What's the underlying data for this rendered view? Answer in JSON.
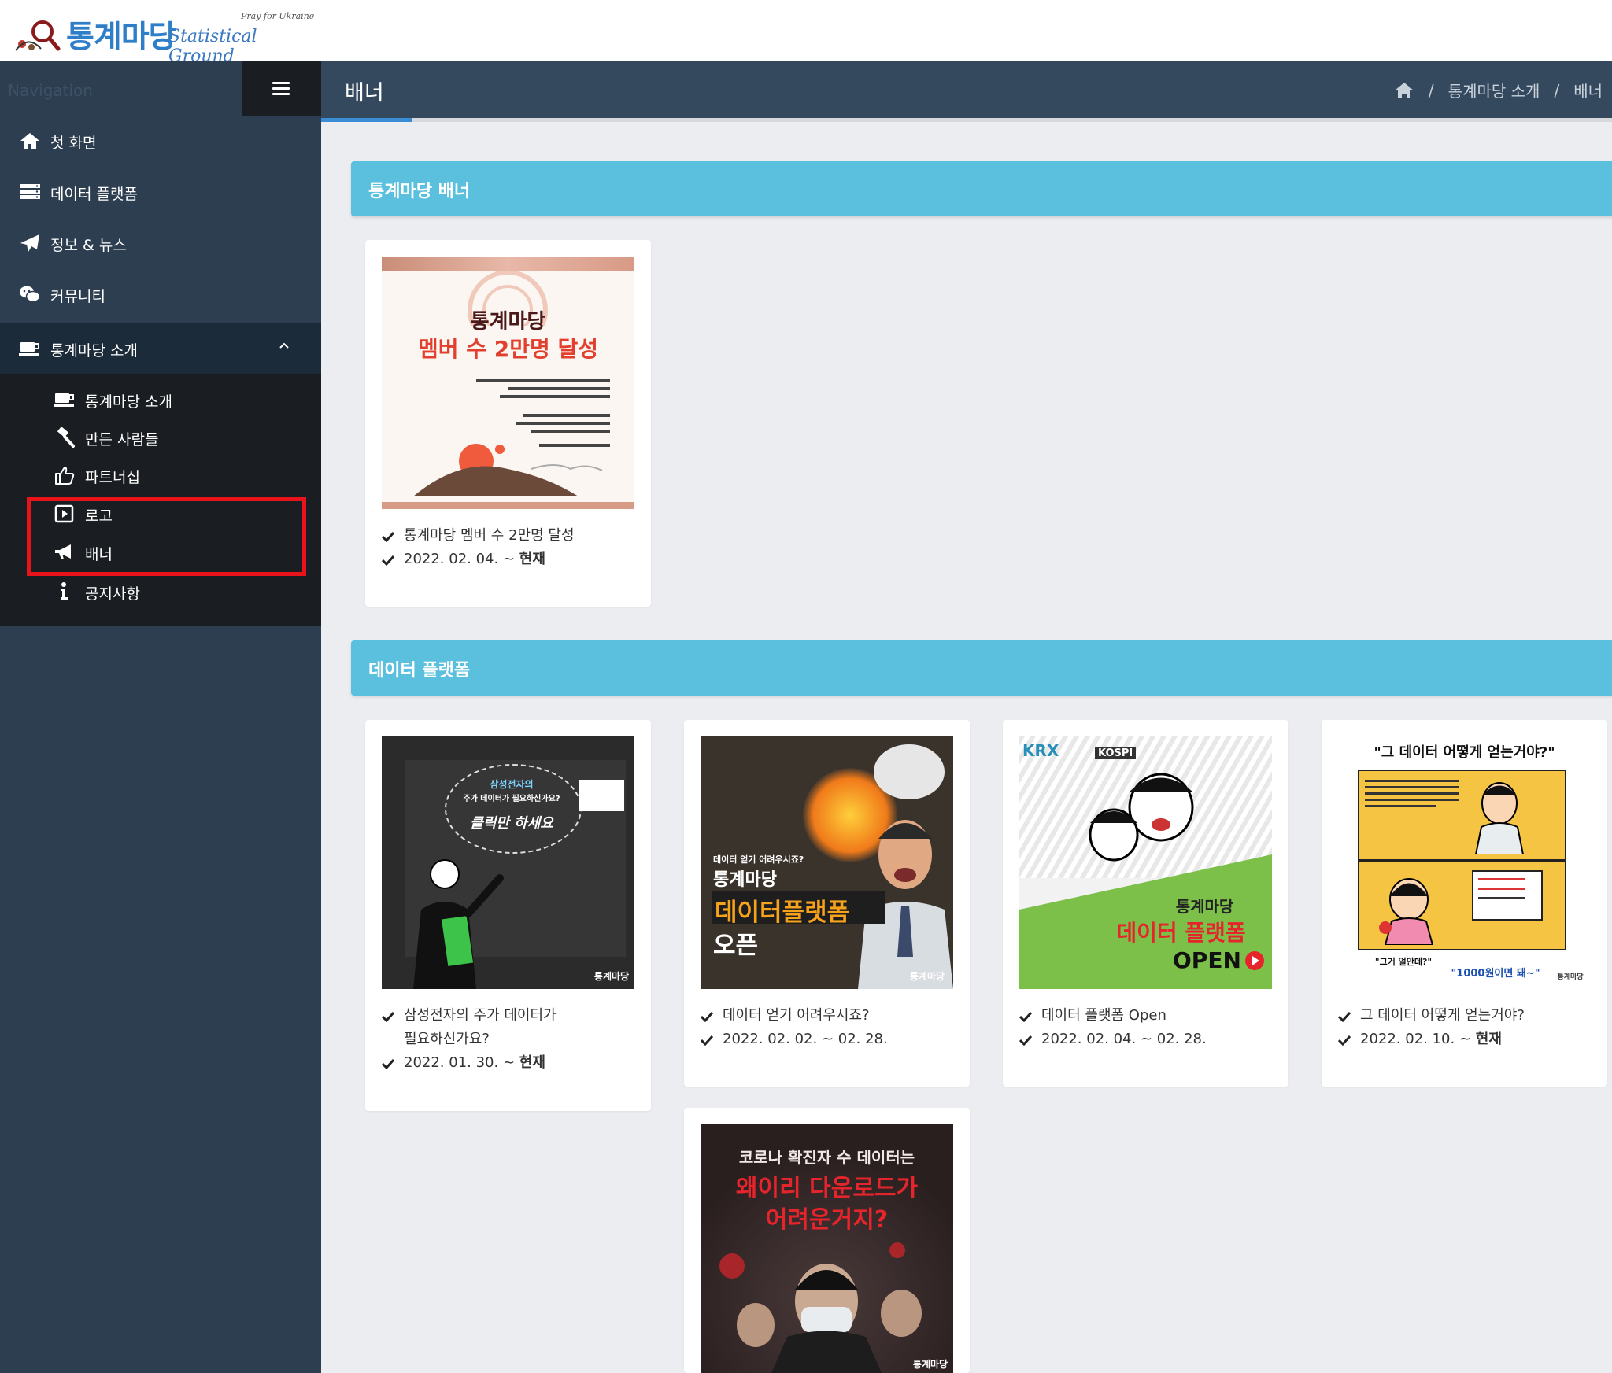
{
  "header": {
    "logo_ko": "통계마당",
    "logo_en": "Statistical Ground",
    "logo_tagline": "Pray for Ukraine"
  },
  "sidebar": {
    "caption": "Navigation",
    "items": [
      {
        "label": "첫 화면",
        "icon": "home-icon"
      },
      {
        "label": "데이터 플랫폼",
        "icon": "server-icon"
      },
      {
        "label": "정보 & 뉴스",
        "icon": "paper-plane-icon"
      },
      {
        "label": "커뮤니티",
        "icon": "wechat-icon"
      },
      {
        "label": "통계마당 소개",
        "icon": "coffee-icon"
      }
    ],
    "submenu": [
      {
        "label": "통계마당 소개",
        "icon": "coffee-icon"
      },
      {
        "label": "만든 사람들",
        "icon": "gavel-icon"
      },
      {
        "label": "파트너십",
        "icon": "thumbs-up-icon"
      },
      {
        "label": "로고",
        "icon": "play-square-icon"
      },
      {
        "label": "배너",
        "icon": "bullhorn-icon"
      },
      {
        "label": "공지사항",
        "icon": "info-icon"
      }
    ]
  },
  "page": {
    "title": "배너",
    "breadcrumb": [
      "통계마당 소개",
      "배너"
    ]
  },
  "sections": [
    {
      "title": "통계마당 배너",
      "cards": [
        {
          "thumb_title": "통계마당",
          "thumb_subtitle": "멤버 수 2만명 달성",
          "lines": [
            "통계마당 멤버 수 2만명 달성"
          ],
          "date": "2022. 02. 04. ~ ",
          "date_bold": "현재"
        }
      ]
    },
    {
      "title": "데이터 플랫폼",
      "cards": [
        {
          "thumb_title": "삼성전자의",
          "thumb_subtitle": "클릭만 하세요",
          "thumb_mid": "주가 데이터가 필요하신가요?",
          "thumb_brand": "통계마당",
          "lines": [
            "삼성전자의 주가 데이터가",
            "필요하신가요?"
          ],
          "date": "2022. 01. 30. ~ ",
          "date_bold": "현재"
        },
        {
          "thumb_small": "데이터 얻기 어려우시죠?",
          "thumb_title": "통계마당",
          "thumb_subtitle": "데이터플랫폼",
          "thumb_mid": "오픈",
          "thumb_brand": "통계마당",
          "lines": [
            "데이터 얻기 어려우시죠?"
          ],
          "date": "2022. 02. 02. ~ 02. 28.",
          "date_bold": ""
        },
        {
          "thumb_title": "통계마당",
          "thumb_subtitle": "데이터 플랫폼",
          "thumb_mid": "OPEN",
          "thumb_small": "KRX",
          "thumb_brand": "KOSPI",
          "lines": [
            "데이터 플랫폼 Open"
          ],
          "date": "2022. 02. 04. ~ 02. 28.",
          "date_bold": ""
        },
        {
          "thumb_title": "\"그 데이터 어떻게 얻는거야?\"",
          "thumb_subtitle": "\"그거 얼만데?\"",
          "thumb_mid": "\"1000원이면 돼~\"",
          "thumb_brand": "통계마당",
          "lines": [
            "그 데이터 어떻게 얻는거야?"
          ],
          "date": "2022. 02. 10. ~ ",
          "date_bold": "현재"
        },
        {
          "thumb_title": "코로나 확진자 수 데이터는",
          "thumb_subtitle": "왜이리 다운로드가",
          "thumb_mid": "어려운거지?",
          "thumb_brand": "통계마당"
        }
      ]
    }
  ],
  "colors": {
    "sidebar": "#2c3e50",
    "submenu": "#1a1d22",
    "content_header": "#34495e",
    "section_bar": "#5bc0de",
    "highlight": "#e8131b",
    "accent": "#3a8dd4"
  }
}
